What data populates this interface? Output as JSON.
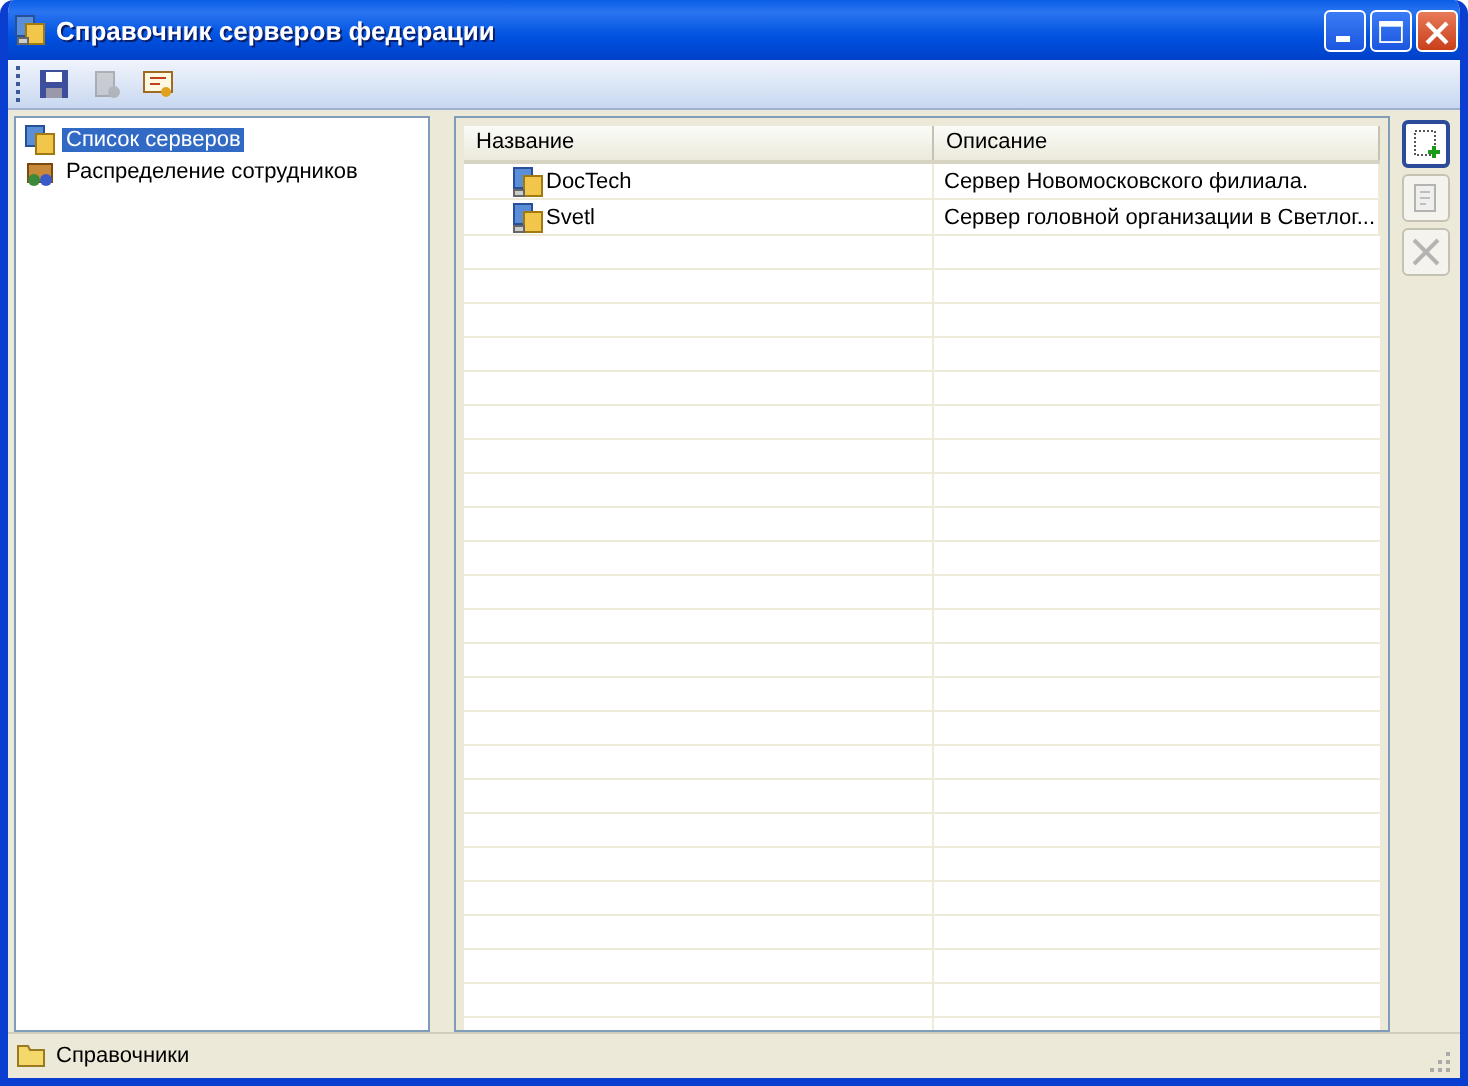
{
  "window": {
    "title": "Справочник серверов федерации"
  },
  "toolbar": [
    {
      "kind": "save",
      "disabled": false
    },
    {
      "kind": "server",
      "disabled": true
    },
    {
      "kind": "certificate",
      "disabled": false
    }
  ],
  "tree": [
    {
      "label": "Список серверов",
      "kind": "servers",
      "selected": true
    },
    {
      "label": "Распределение сотрудников",
      "kind": "people",
      "selected": false
    }
  ],
  "table": {
    "columns": [
      "Название",
      "Описание"
    ],
    "rows": [
      {
        "name": "DocTech",
        "description": "Сервер Новомосковского филиала."
      },
      {
        "name": "Svetl",
        "description": "Сервер головной организации в Светлог..."
      }
    ]
  },
  "side_buttons": [
    {
      "kind": "add",
      "disabled": false
    },
    {
      "kind": "edit",
      "disabled": true
    },
    {
      "kind": "delete",
      "disabled": true
    }
  ],
  "status_bar": {
    "text": "Справочники"
  }
}
